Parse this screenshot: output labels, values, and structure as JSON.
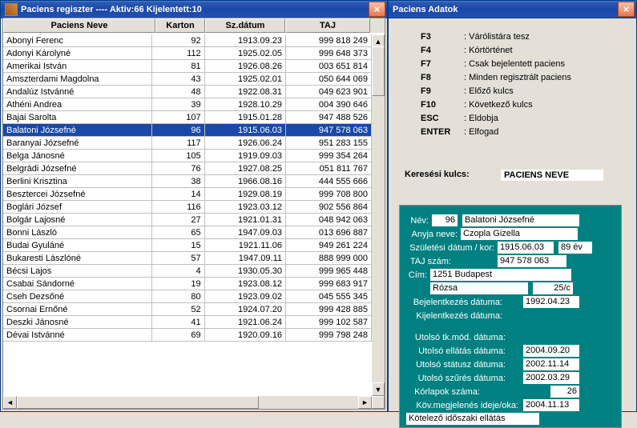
{
  "w1": {
    "title": "Paciens regiszter ---- Aktiv:66  Kijelentett:10"
  },
  "w2": {
    "title": "Paciens Adatok"
  },
  "cols": {
    "c1": "Paciens Neve",
    "c2": "Karton",
    "c3": "Sz.dátum",
    "c4": "TAJ"
  },
  "rows": [
    {
      "n": "Abonyi Ferenc",
      "k": "92",
      "d": "1913.09.23",
      "t": "999 818 249"
    },
    {
      "n": "Adonyi Károlyné",
      "k": "112",
      "d": "1925.02.05",
      "t": "999 648 373"
    },
    {
      "n": "Amerikai István",
      "k": "81",
      "d": "1926.08.26",
      "t": "003 651 814"
    },
    {
      "n": "Amszterdami Magdolna",
      "k": "43",
      "d": "1925.02.01",
      "t": "050 644 069"
    },
    {
      "n": "Andalúz Istvánné",
      "k": "48",
      "d": "1922.08.31",
      "t": "049 623 901"
    },
    {
      "n": "Athéni Andrea",
      "k": "39",
      "d": "1928.10.29",
      "t": "004 390 646"
    },
    {
      "n": "Bajai Sarolta",
      "k": "107",
      "d": "1915.01.28",
      "t": "947 488 526"
    },
    {
      "n": "Balatoni Józsefné",
      "k": "96",
      "d": "1915.06.03",
      "t": "947 578 063"
    },
    {
      "n": "Baranyai Józsefné",
      "k": "117",
      "d": "1926.06.24",
      "t": "951 283 155"
    },
    {
      "n": "Belga Jánosné",
      "k": "105",
      "d": "1919.09.03",
      "t": "999 354 264"
    },
    {
      "n": "Belgrádi Józsefné",
      "k": "76",
      "d": "1927.08.25",
      "t": "051 811 767"
    },
    {
      "n": "Berlini Krisztina",
      "k": "38",
      "d": "1966.08.16",
      "t": "444 555 666"
    },
    {
      "n": "Besztercei Józsefné",
      "k": "14",
      "d": "1929.08.19",
      "t": "999 708 800"
    },
    {
      "n": "Boglári József",
      "k": "116",
      "d": "1923.03.12",
      "t": "902 556 864"
    },
    {
      "n": "Bolgár Lajosné",
      "k": "27",
      "d": "1921.01.31",
      "t": "048 942 063"
    },
    {
      "n": "Bonni László",
      "k": "65",
      "d": "1947.09.03",
      "t": "013 696 887"
    },
    {
      "n": "Budai Gyuláné",
      "k": "15",
      "d": "1921.11.06",
      "t": "949 261 224"
    },
    {
      "n": "Bukaresti Lászlóné",
      "k": "57",
      "d": "1947.09.11",
      "t": "888 999 000"
    },
    {
      "n": "Bécsi Lajos",
      "k": "4",
      "d": "1930.05.30",
      "t": "999 965 448"
    },
    {
      "n": "Csabai Sándorné",
      "k": "19",
      "d": "1923.08.12",
      "t": "999 683 917"
    },
    {
      "n": "Cseh Dezsőné",
      "k": "80",
      "d": "1923.09.02",
      "t": "045 555 345"
    },
    {
      "n": "Csornai Ernőné",
      "k": "52",
      "d": "1924.07.20",
      "t": "999 428 885"
    },
    {
      "n": "Deszki Jánosné",
      "k": "41",
      "d": "1921.06.24",
      "t": "999 102 587"
    },
    {
      "n": "Dévai Istvánné",
      "k": "69",
      "d": "1920.09.16",
      "t": "999 798 248"
    }
  ],
  "sel": 7,
  "funcs": [
    {
      "k": "F3",
      "l": ": Várólistára tesz"
    },
    {
      "k": "F4",
      "l": ": Kórtörténet"
    },
    {
      "k": "F7",
      "l": ": Csak bejelentett paciens"
    },
    {
      "k": "F8",
      "l": ": Minden regisztrált paciens"
    },
    {
      "k": "F9",
      "l": ": Előző kulcs"
    },
    {
      "k": "F10",
      "l": ": Következő kulcs"
    },
    {
      "k": "ESC",
      "l": ": Eldobja"
    },
    {
      "k": "ENTER",
      "l": ": Elfogad"
    }
  ],
  "search": {
    "label": "Keresési kulcs:",
    "value": "PACIENS NEVE"
  },
  "det": {
    "nev_l": "Név:",
    "nev_k": "96",
    "nev": "Balatoni Józsefné",
    "anya_l": "Anyja neve:",
    "anya": "Czopla Gizella",
    "szul_l": "Születési dátum / kor:",
    "szul": "1915.06.03",
    "kor": "89 év",
    "taj_l": "TAJ szám:",
    "taj": "947 578 063",
    "cim_l": "Cím:",
    "cim1": "1251 Budapest",
    "cim2": "Rózsa",
    "cim3": "25/c",
    "bej_l": "Bejelentkezés dátuma:",
    "bej": "1992.04.23",
    "kij_l": "Kijelentkezés dátuma:",
    "utk_l": "Utolsó tk.mód. dátuma:",
    "uel_l": "Utolsó ellátás dátuma:",
    "uel": "2004.09.20",
    "ust_l": "Utolsó státusz dátuma:",
    "ust": "2002.11.14",
    "usz_l": "Utolsó szűrés dátuma:",
    "usz": "2002.03.29",
    "kor_l": "Kórlapok száma:",
    "korsz": "26",
    "kov_l": "Köv.megjelenés ideje/oka:",
    "kov": "2004.11.13",
    "kot_l": "Kötelező időszaki ellátás"
  }
}
